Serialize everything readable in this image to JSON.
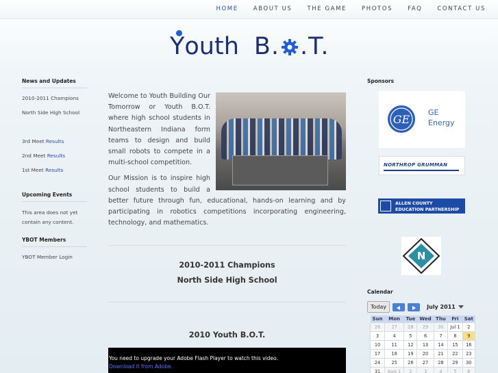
{
  "nav": [
    "HOME",
    "ABOUT US",
    "THE GAME",
    "PHOTOS",
    "FAQ",
    "CONTACT US"
  ],
  "logo": {
    "y": "Y",
    "outh": "outh",
    "b": "B.",
    "t": ".T."
  },
  "left": {
    "news_title": "News and Updates",
    "news_items": [
      "2010-2011 Champions",
      "North Side High School"
    ],
    "results": [
      {
        "prefix": "3rd Meet ",
        "link": "Results"
      },
      {
        "prefix": "2nd Meet ",
        "link": "Results"
      },
      {
        "prefix": "1st Meet ",
        "link": "Results"
      }
    ],
    "events_title": "Upcoming Events",
    "events_text": "This area does not yet contain any content.",
    "members_title": "YBOT Members",
    "members_link": "YBOT Member Login"
  },
  "main": {
    "p1": "Welcome to Youth Building Our Tomorrow or Youth B.O.T. where high school students in Northeastern Indiana form teams to design and build small robots to compete in a multi-school competition.",
    "p2": "Our Mission is to inspire high school students to build a better future through fun, educational, hands-on learning and by participating in robotics competitions incorporating engineering, technology, and mathematics.",
    "champ1": "2010-2011 Champions",
    "champ2": "North Side High School",
    "ybot_title": "2010 Youth B.O.T.",
    "flash_text": "You need to upgrade your Adobe Flash Player to watch this video.",
    "flash_link": "Download it from Adobe."
  },
  "right": {
    "sponsors_title": "Sponsors",
    "ge_line1": "GE",
    "ge_line2": "Energy",
    "ng": "NORTHROP GRUMMAN",
    "allen_line1": "ALLEN COUNTY",
    "allen_line2": "EDUCATION PARTNERSHIP",
    "calendar_title": "Calendar",
    "today": "Today",
    "month": "July 2011",
    "days": [
      "Sun",
      "Mon",
      "Tue",
      "Wed",
      "Thu",
      "Fri",
      "Sat"
    ],
    "weeks": [
      [
        "26",
        "27",
        "28",
        "29",
        "30",
        "Jul 1",
        "2"
      ],
      [
        "3",
        "4",
        "5",
        "6",
        "7",
        "8",
        "9"
      ],
      [
        "10",
        "11",
        "12",
        "13",
        "14",
        "15",
        "16"
      ],
      [
        "17",
        "18",
        "19",
        "20",
        "21",
        "22",
        "23"
      ],
      [
        "24",
        "25",
        "26",
        "27",
        "28",
        "29",
        "30"
      ],
      [
        "31",
        "Aug 1",
        "2",
        "3",
        "4",
        "5",
        "6"
      ]
    ]
  },
  "colors": {
    "accent": "#2a49b8",
    "logo": "#1a2f7a",
    "calendar_header": "#c9d7ef",
    "today": "#f7df8a"
  }
}
